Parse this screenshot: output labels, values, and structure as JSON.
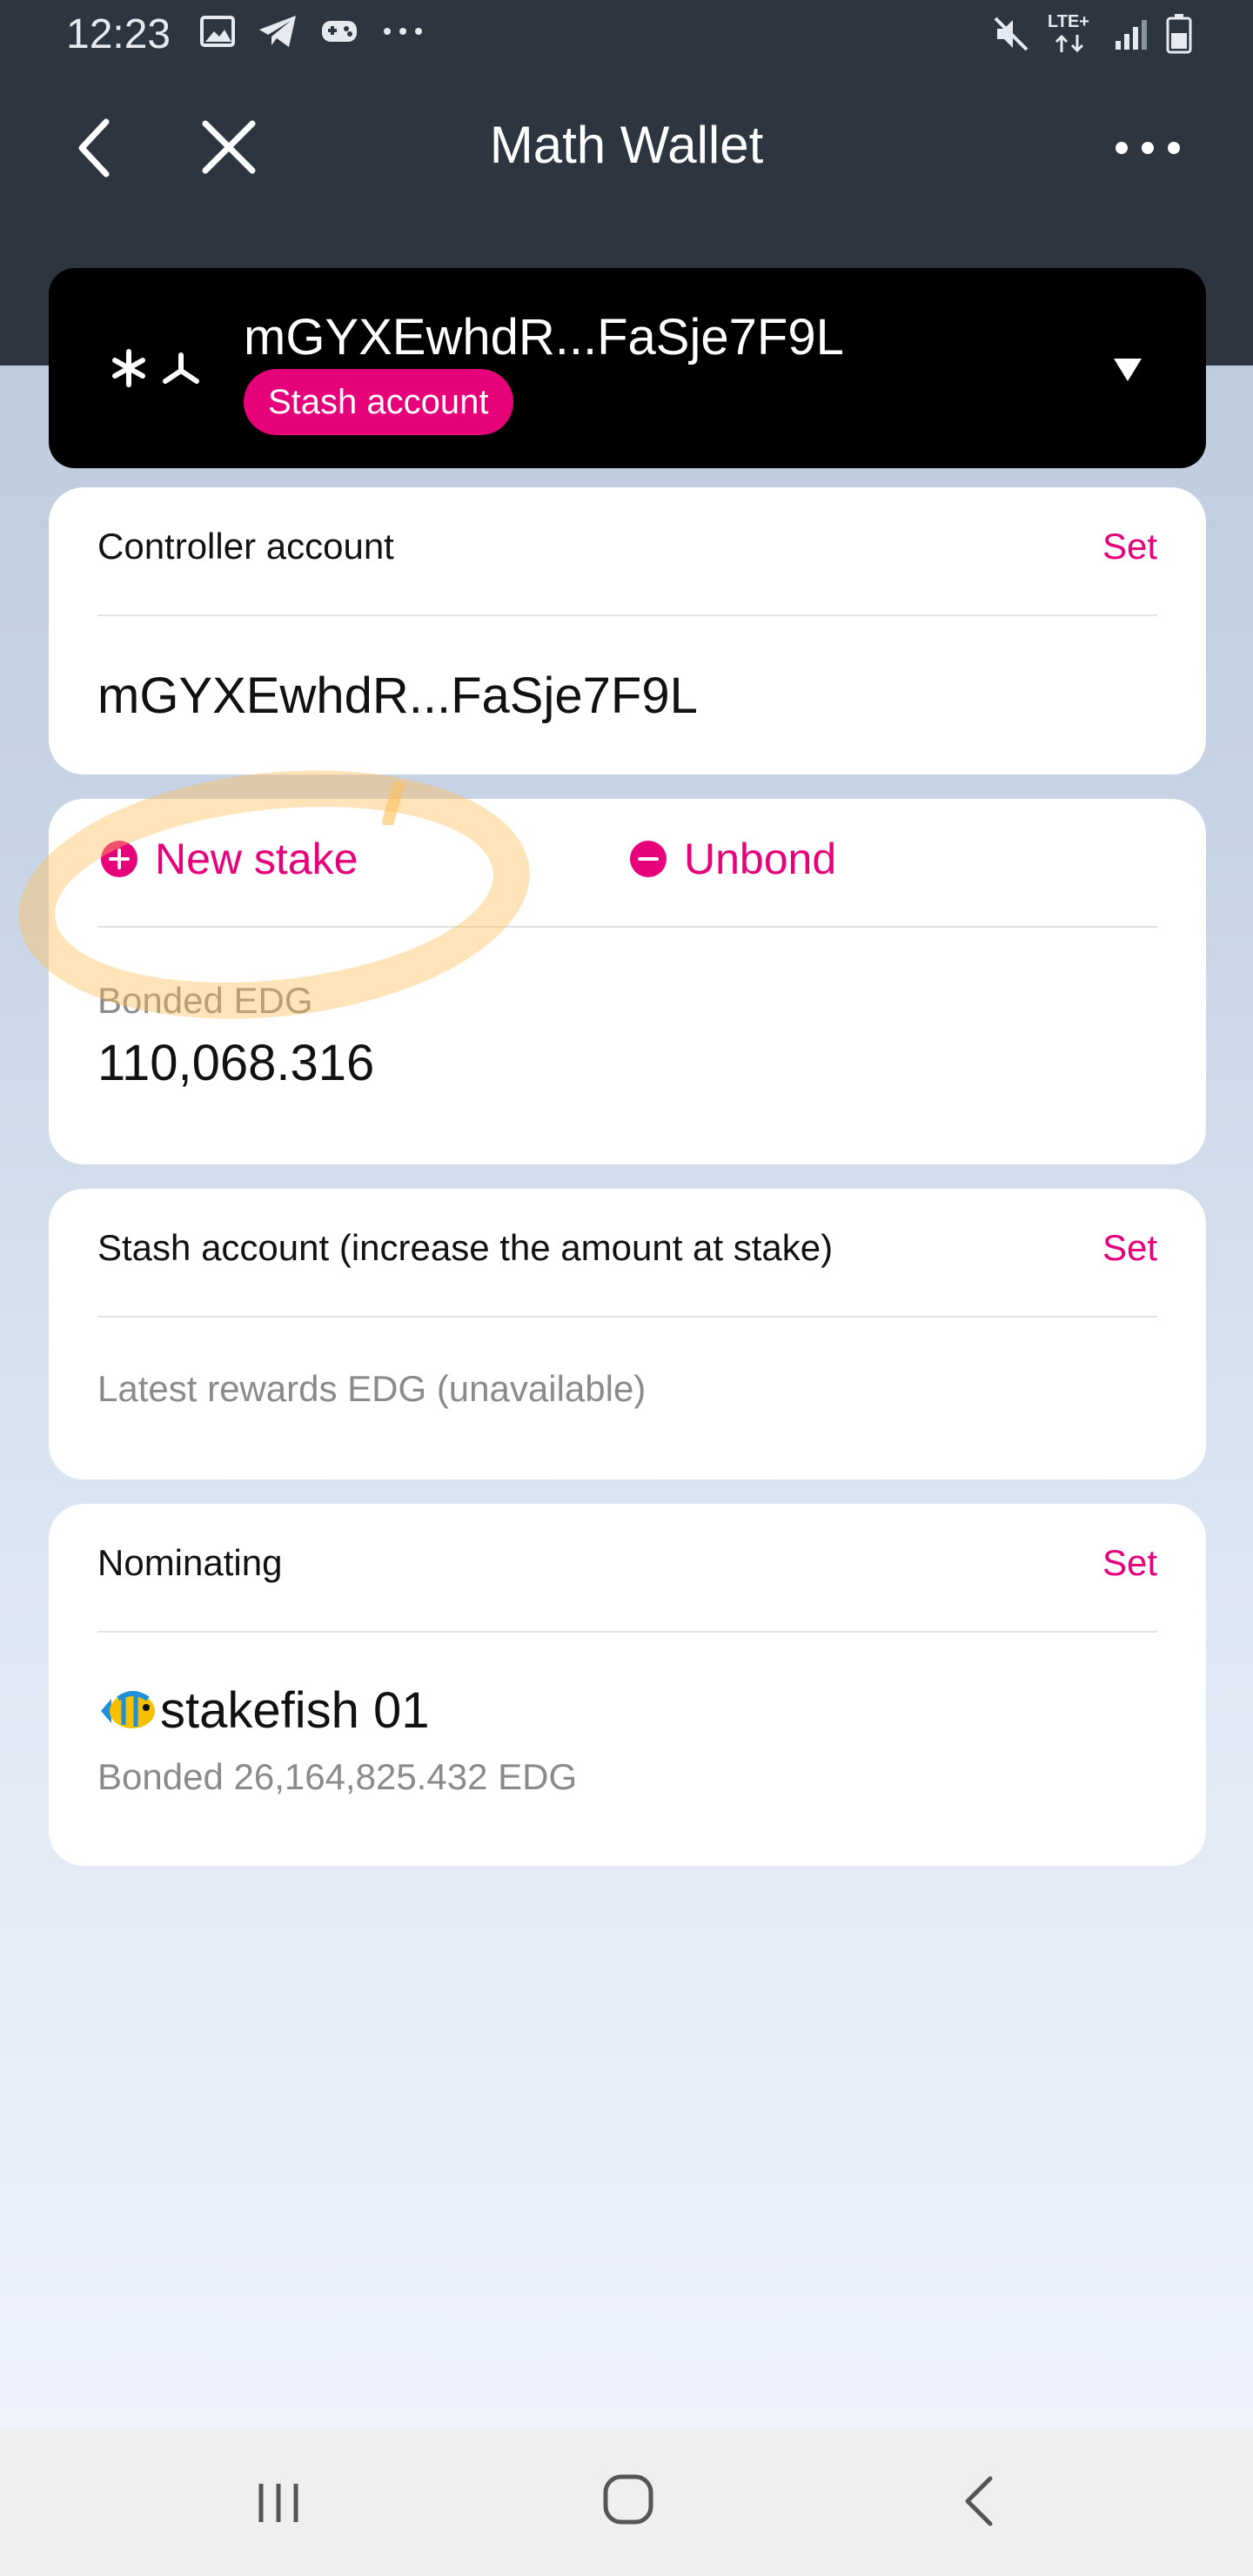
{
  "status_bar": {
    "time": "12:23",
    "network": "LTE+",
    "left_icons": [
      "gallery-icon",
      "telegram-icon",
      "game-icon",
      "more-dots-icon"
    ],
    "right_icons": [
      "mute-icon",
      "lte-icon",
      "signal-icon",
      "battery-icon"
    ]
  },
  "app_bar": {
    "title": "Math Wallet"
  },
  "account": {
    "address": "mGYXEwhdR...FaSje7F9L",
    "badge": "Stash account"
  },
  "controller": {
    "label": "Controller account",
    "set_label": "Set",
    "value": "mGYXEwhdR...FaSje7F9L"
  },
  "bond": {
    "new_stake_label": "New stake",
    "unbond_label": "Unbond",
    "bonded_label": "Bonded EDG",
    "bonded_value": "110,068.316"
  },
  "stash": {
    "label": "Stash account (increase the amount at stake)",
    "set_label": "Set",
    "rewards_label": "Latest rewards EDG (unavailable)"
  },
  "nominating": {
    "label": "Nominating",
    "set_label": "Set",
    "validator_emoji": "🐠",
    "validator_name": "stakefish 01",
    "validator_bonded": "Bonded 26,164,825.432 EDG"
  },
  "colors": {
    "accent": "#e6007a",
    "header_bg": "#2d3640",
    "account_card_bg": "#000000"
  }
}
